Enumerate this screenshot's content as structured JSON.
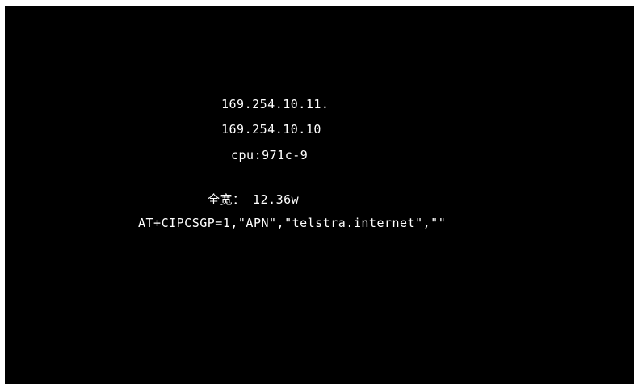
{
  "display": {
    "ip_address_1": "169.254.10.11.",
    "ip_address_2": "169.254.10.10",
    "cpu_temp": "cpu:971c-9",
    "power_reading": "全宽： 12.36w",
    "at_command": "AT+CIPCSGP=1,\"APN\",\"telstra.internet\",\"\""
  },
  "colors": {
    "background": "#000000",
    "text": "#ffffff",
    "frame": "#ffffff"
  }
}
